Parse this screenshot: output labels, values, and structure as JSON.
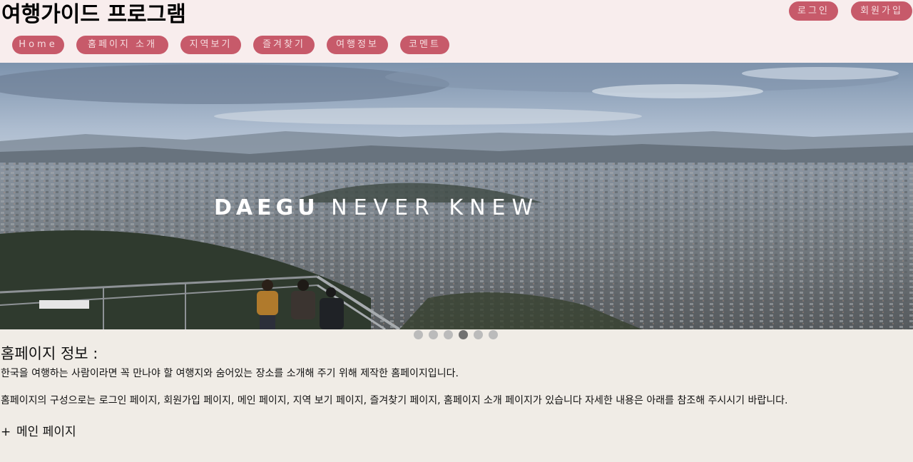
{
  "header": {
    "site_title": "여행가이드 프로그램",
    "login_label": "로그인",
    "signup_label": "회원가입"
  },
  "nav": {
    "items": [
      {
        "label": "Home"
      },
      {
        "label": "홈페이지 소개"
      },
      {
        "label": "지역보기"
      },
      {
        "label": "즐겨찾기"
      },
      {
        "label": "여행정보"
      },
      {
        "label": "코멘트"
      }
    ]
  },
  "hero": {
    "caption_bold": "DAEGU",
    "caption_thin": "NEVER KNEW",
    "slide_count": 6,
    "active_slide": 4
  },
  "content": {
    "title": "홈페이지 정보 :",
    "paragraph1": "한국을 여행하는 사람이라면 꼭 만나야 할 여행지와 숨어있는 장소를 소개해 주기 위해 제작한 홈페이지입니다.",
    "paragraph2": "홈페이지의 구성으로는 로그인 페이지, 회원가입 페이지, 메인 페이지, 지역 보기 페이지, 즐겨찾기 페이지, 홈페이지 소개 페이지가 있습니다 자세한 내용은 아래를 참조해 주시시기 바랍니다.",
    "section_plus": "+",
    "section_label": "메인 페이지"
  },
  "colors": {
    "header_bg": "#f8eded",
    "pill_bg": "#c75a6a",
    "pill_text": "#f6dde0",
    "page_bg": "#f0ece6",
    "dot_inactive": "#bbbbbb",
    "dot_active": "#717171"
  }
}
